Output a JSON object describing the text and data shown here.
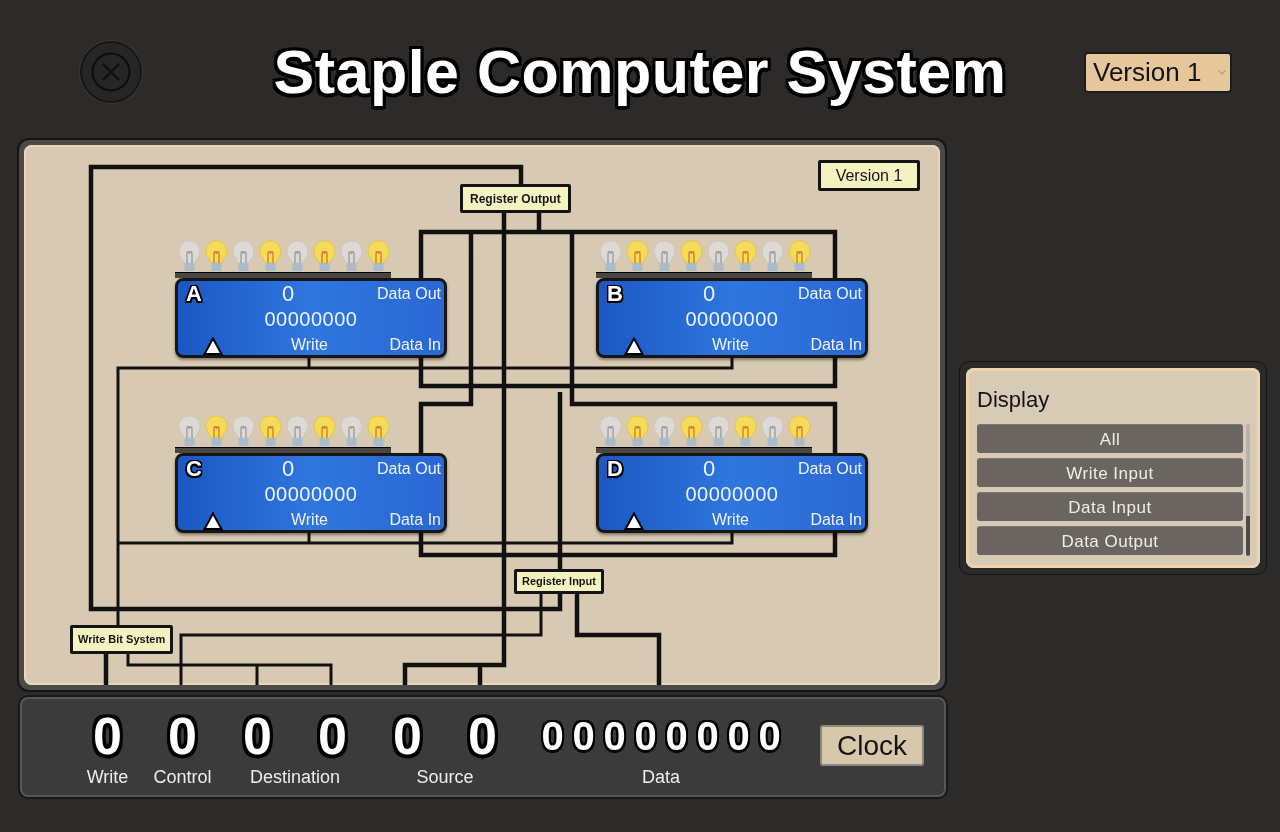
{
  "title": "Staple Computer System",
  "version_select": {
    "value": "Version 1"
  },
  "circuit": {
    "version_label": "Version 1",
    "register_output_label": "Register Output",
    "register_input_label": "Register Input",
    "write_bit_system_label": "Write Bit System",
    "registers": [
      {
        "name": "A",
        "value": "0",
        "binary": "00000000",
        "data_out": "Data Out",
        "write": "Write",
        "data_in": "Data In",
        "bulbs": [
          {
            "lit": false
          },
          {
            "lit": true
          },
          {
            "lit": false
          },
          {
            "lit": true
          },
          {
            "lit": false
          },
          {
            "lit": true
          },
          {
            "lit": false
          },
          {
            "lit": true
          }
        ]
      },
      {
        "name": "B",
        "value": "0",
        "binary": "00000000",
        "data_out": "Data Out",
        "write": "Write",
        "data_in": "Data In",
        "bulbs": [
          {
            "lit": false
          },
          {
            "lit": true
          },
          {
            "lit": false
          },
          {
            "lit": true
          },
          {
            "lit": false
          },
          {
            "lit": true
          },
          {
            "lit": false
          },
          {
            "lit": true
          }
        ]
      },
      {
        "name": "C",
        "value": "0",
        "binary": "00000000",
        "data_out": "Data Out",
        "write": "Write",
        "data_in": "Data In",
        "bulbs": [
          {
            "lit": false
          },
          {
            "lit": true
          },
          {
            "lit": false
          },
          {
            "lit": true
          },
          {
            "lit": false
          },
          {
            "lit": true
          },
          {
            "lit": false
          },
          {
            "lit": true
          }
        ]
      },
      {
        "name": "D",
        "value": "0",
        "binary": "00000000",
        "data_out": "Data Out",
        "write": "Write",
        "data_in": "Data In",
        "bulbs": [
          {
            "lit": false
          },
          {
            "lit": true
          },
          {
            "lit": false
          },
          {
            "lit": true
          },
          {
            "lit": false
          },
          {
            "lit": true
          },
          {
            "lit": false
          },
          {
            "lit": true
          }
        ]
      }
    ]
  },
  "control_bar": {
    "fields": [
      {
        "label": "Write",
        "digits": [
          "0"
        ]
      },
      {
        "label": "Control",
        "digits": [
          "0"
        ]
      },
      {
        "label": "Destination",
        "digits": [
          "0",
          "0"
        ]
      },
      {
        "label": "Source",
        "digits": [
          "0",
          "0"
        ]
      },
      {
        "label": "Data",
        "digits": [
          "0",
          "0",
          "0",
          "0",
          "0",
          "0",
          "0",
          "0"
        ]
      }
    ],
    "clock_button": "Clock"
  },
  "display_panel": {
    "title": "Display",
    "options": [
      "All",
      "Write Input",
      "Data Input",
      "Data Output"
    ]
  }
}
